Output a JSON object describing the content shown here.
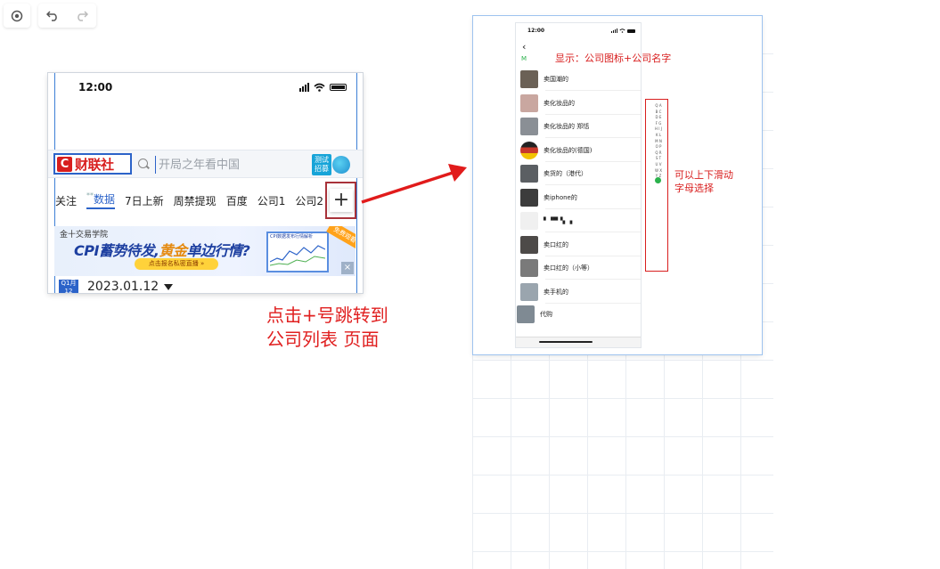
{
  "toolbar": {
    "target_icon": "target-icon",
    "undo_icon": "undo-icon",
    "redo_icon": "redo-icon"
  },
  "left_phone": {
    "status_time": "12:00",
    "logo_letter": "C",
    "logo_name": "财联社",
    "search_placeholder": "开局之年看中国",
    "promo_badge": "测试\n招募",
    "tabs": [
      "关注",
      "数据",
      "7日上新",
      "周禁提现",
      "百度",
      "公司1",
      "公司2"
    ],
    "active_tab_index": 1,
    "active_tab_prefix": "**",
    "plus_label": "+",
    "banner": {
      "school": "金十交易学院",
      "headline_a": "CPI蓄势待发,",
      "headline_b": "黄金",
      "headline_c": "单边行情?",
      "cta": "点击报名私密直播 »",
      "chart_title": "CPI数据发布行情解析",
      "tag": "免费观看",
      "close": "×"
    },
    "date_badge_top": "Q1月",
    "date_badge_bottom": "12",
    "date_text": "2023.01.12"
  },
  "caption": "点击+号跳转到\n公司列表 页面",
  "right_phone": {
    "status_time": "12:00",
    "back": "‹",
    "section_letter": "M",
    "annotation_top": "显示：公司图标+公司名字",
    "annotation_side": "可以上下滑动\n字母选择",
    "companies": [
      {
        "label": "卖国潮的",
        "color": "#6b6156"
      },
      {
        "label": "卖化妆品的",
        "color": "#c9a7a0"
      },
      {
        "label": "卖化妆品的 郑恬",
        "color": "#8a8f95"
      },
      {
        "label": "卖化妆品的(德国)",
        "color": "#c8392b"
      },
      {
        "label": "卖货的（港代）",
        "color": "#5b5f63"
      },
      {
        "label": "卖iphone的",
        "color": "#3c3c3c"
      },
      {
        "label": "▘▝▀▝▖▗",
        "color": "#f0f0f0"
      },
      {
        "label": "卖口红的",
        "color": "#4d4a48"
      },
      {
        "label": "卖口红的（小等）",
        "color": "#7a7a7a"
      },
      {
        "label": "卖手机的",
        "color": "#9aa5ae"
      },
      {
        "label": "代购",
        "color": "#7f8a93"
      }
    ],
    "alphabet": "Q A B C D E F G H I J K L M N O P Q R S T U V W X Y Z #"
  },
  "colors": {
    "accent_blue": "#2c63c9",
    "annotation_red": "#d81e1e",
    "index_green": "#2bb24c"
  }
}
